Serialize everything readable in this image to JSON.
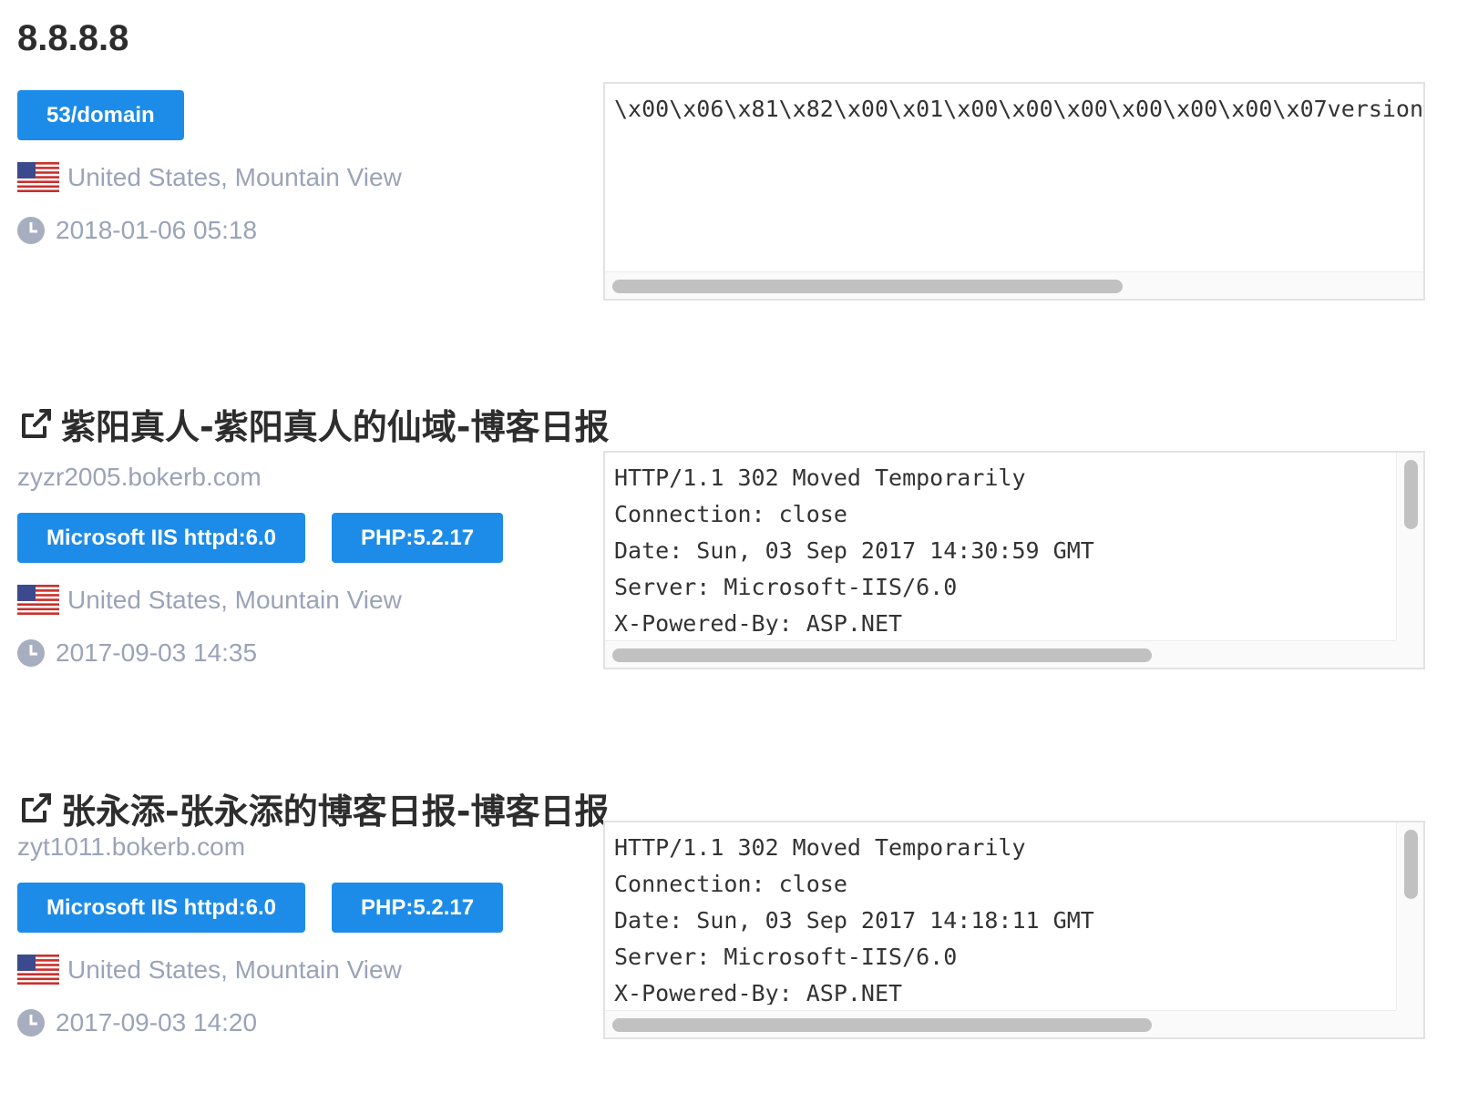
{
  "results": [
    {
      "title": "8.8.8.8",
      "tags": [
        "53/domain"
      ],
      "location": "United States, Mountain View",
      "time": "2018-01-06 05:18",
      "banner": "\\x00\\x06\\x81\\x82\\x00\\x01\\x00\\x00\\x00\\x00\\x00\\x00\\x07version"
    },
    {
      "title": "紫阳真人-紫阳真人的仙域-博客日报",
      "host": "zyzr2005.bokerb.com",
      "tags": [
        "Microsoft IIS httpd:6.0",
        "PHP:5.2.17"
      ],
      "location": "United States, Mountain View",
      "time": "2017-09-03 14:35",
      "banner": "HTTP/1.1 302 Moved Temporarily\nConnection: close\nDate: Sun, 03 Sep 2017 14:30:59 GMT\nServer: Microsoft-IIS/6.0\nX-Powered-By: ASP.NET"
    },
    {
      "title": "张永添-张永添的博客日报-博客日报",
      "host": "zyt1011.bokerb.com",
      "tags": [
        "Microsoft IIS httpd:6.0",
        "PHP:5.2.17"
      ],
      "location": "United States, Mountain View",
      "time": "2017-09-03 14:20",
      "banner": "HTTP/1.1 302 Moved Temporarily\nConnection: close\nDate: Sun, 03 Sep 2017 14:18:11 GMT\nServer: Microsoft-IIS/6.0\nX-Powered-By: ASP.NET"
    }
  ],
  "icons": {
    "flag": "us-flag-icon",
    "clock": "clock-icon",
    "link": "external-link-icon"
  },
  "colors": {
    "tag_bg": "#1d8ce9",
    "muted_text": "#9aa3b8",
    "title_text": "#2d2d2d"
  }
}
